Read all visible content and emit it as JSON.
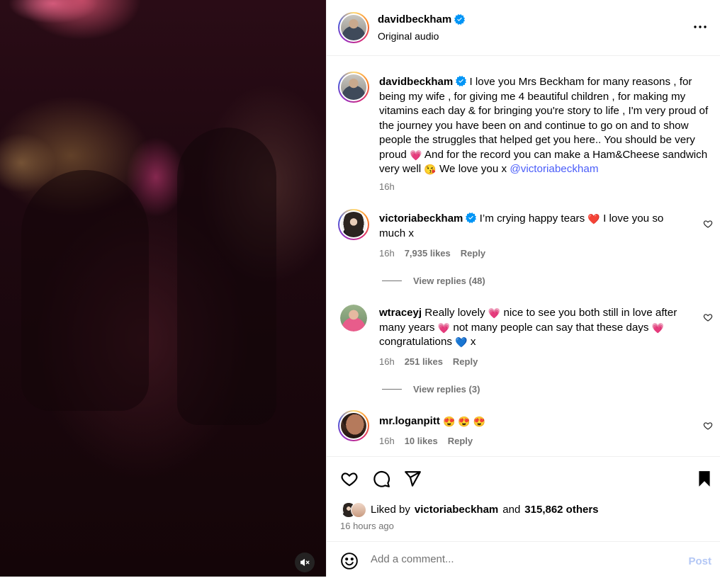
{
  "media": {
    "type": "video",
    "mute_icon": "speaker-muted-icon"
  },
  "post": {
    "author": "davidbeckham",
    "audio": "Original audio",
    "caption_text": "I love you Mrs Beckham for many reasons , for being my wife , for giving me 4 beautiful children , for making my vitamins each day & for bringing you're story to life , I'm very proud of the journey you have been on and continue to go on and to show people the struggles that helped get you here.. You should be very proud",
    "caption_emoji_1": "💗",
    "caption_text_2": "And for the record you can make a Ham&Cheese sandwich very well",
    "caption_emoji_2": "😘",
    "caption_text_3": "We love you x",
    "caption_mention": "@victoriabeckham",
    "caption_time": "16h"
  },
  "comments": [
    {
      "username": "victoriabeckham",
      "verified": true,
      "text_1": "I’m crying happy tears",
      "emoji_1": "❤️",
      "text_2": "I love you so much x",
      "time": "16h",
      "likes": "7,935 likes",
      "reply_label": "Reply",
      "view_replies": "View replies (48)"
    },
    {
      "username": "wtraceyj",
      "verified": false,
      "text_1": "Really lovely",
      "emoji_1": "💗",
      "text_2": "nice to see you both still in love after many years",
      "emoji_2": "💗",
      "text_3": "not many people can say that these days",
      "emoji_3": "💗",
      "text_4": "congratulations",
      "emoji_4": "💙",
      "text_5": "x",
      "time": "16h",
      "likes": "251 likes",
      "reply_label": "Reply",
      "view_replies": "View replies (3)"
    },
    {
      "username": "mr.loganpitt",
      "verified": false,
      "emojis": "😍 😍 😍",
      "time": "16h",
      "likes": "10 likes",
      "reply_label": "Reply"
    }
  ],
  "actions": {
    "like_icon": "heart-icon",
    "comment_icon": "comment-icon",
    "share_icon": "paper-plane-icon",
    "save_icon": "bookmark-filled-icon"
  },
  "likes": {
    "prefix": "Liked by",
    "user": "victoriabeckham",
    "conjunction": "and",
    "others": "315,862 others"
  },
  "time_ago": "16 hours ago",
  "comment_box": {
    "placeholder": "Add a comment...",
    "post_label": "Post",
    "emoji_icon": "smiley-icon"
  },
  "colors": {
    "verified": "#0095f6",
    "mention": "#4a5df9",
    "post_disabled": "#b3c7f5",
    "secondary_text": "#737373"
  }
}
